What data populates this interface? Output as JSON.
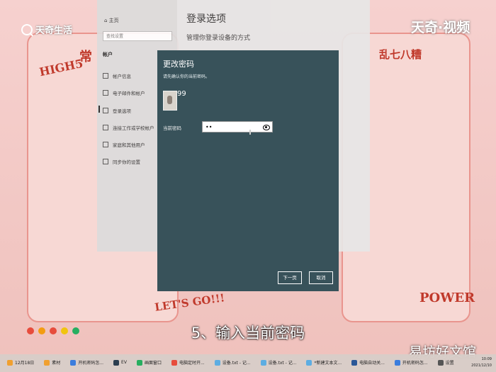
{
  "brand_left": "天奇生活",
  "brand_right": "天奇·视频",
  "wallpaper": {
    "left_note_text": "HIGH5",
    "left_note_text2": "常",
    "right_note_text": "乱七八糟",
    "lets_go": "LET'S GO!!!",
    "power": "POWER"
  },
  "settings": {
    "home": "主页",
    "search_placeholder": "查找设置",
    "section": "帐户",
    "items": [
      "帐户信息",
      "电子邮件和帐户",
      "登录选项",
      "连接工作或学校帐户",
      "家庭和其他用户",
      "同步你的设置"
    ],
    "title": "登录选项",
    "subtitle": "管理你登录设备的方式"
  },
  "dialog": {
    "title": "更改密码",
    "instruction": "请先确认你的当前密码。",
    "username": "99",
    "password_label": "当前密码",
    "password_value": "••",
    "next_button": "下一页",
    "cancel_button": "取消"
  },
  "subtitle": "5、输入当前密码",
  "watermark": "易坊好文馆",
  "taskbar": {
    "tasks": [
      "12月18日",
      "素材",
      "开机密码怎...",
      "EV",
      "画面窗口",
      "电脑定时开...",
      "设备.txt - 记...",
      "设备.txt - 记...",
      "*新建文本文...",
      "电脑自动关...",
      "开机密码怎...",
      "设置"
    ],
    "time": "10:09",
    "date": "2021/12/10"
  },
  "colors": {
    "dialog_bg": "#38525a",
    "wallpaper_bg": "#f3c9c6"
  }
}
